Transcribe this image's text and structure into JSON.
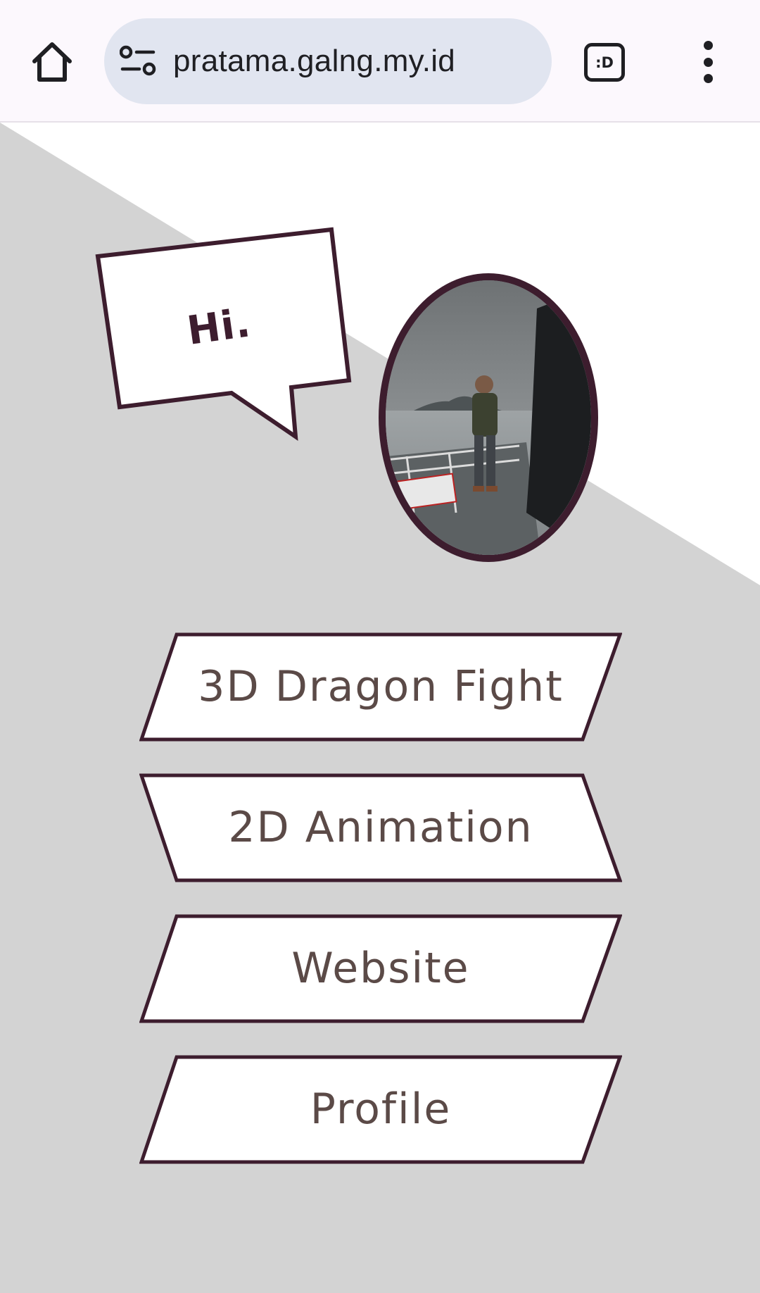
{
  "browser": {
    "url": "pratama.galng.my.id",
    "tab_switcher_label": ":D",
    "icons": {
      "home": "home-icon",
      "site_settings": "site-settings-icon",
      "menu": "more-vert-icon"
    }
  },
  "page": {
    "greeting": "Hi.",
    "nav_buttons": [
      {
        "label": "3D Dragon Fight"
      },
      {
        "label": "2D Animation"
      },
      {
        "label": "Website"
      },
      {
        "label": "Profile"
      }
    ],
    "colors": {
      "accent_dark": "#3d1d2e",
      "background_gray": "#d3d3d3",
      "label_text": "#5b4a47"
    }
  }
}
